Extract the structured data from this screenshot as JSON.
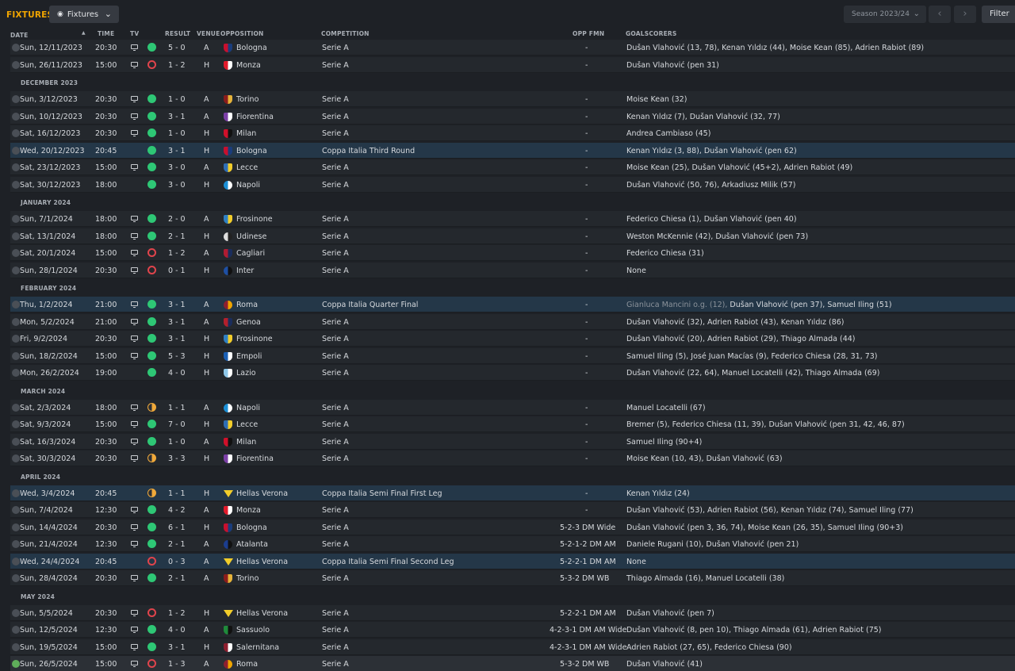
{
  "header": {
    "title": "FIXTURES",
    "view_label": "Fixtures",
    "season_label": "Season 2023/24",
    "filter_label": "Filter",
    "prev_icon": "chevron-left-icon",
    "next_icon": "chevron-right-icon"
  },
  "columns": {
    "date": "DATE",
    "time": "TIME",
    "tv": "TV",
    "result": "RESULT",
    "venue": "VENUE",
    "opposition": "OPPOSITION",
    "competition": "COMPETITION",
    "opp_fmn": "OPP FMN",
    "goalscorers": "GOALSCORERS"
  },
  "colors": {
    "accent": "#f0a500",
    "win": "#2ec775",
    "loss": "#e0444c",
    "draw": "#f0a93a",
    "cup_row": "#243748"
  },
  "rows": [
    {
      "type": "match",
      "date": "Sun, 12/11/2023",
      "time": "20:30",
      "tv": true,
      "outcome": "W",
      "score": "5 - 0",
      "venue": "A",
      "opponent": "Bologna",
      "crest": "#c8102e",
      "crest2": "#1a3d7c",
      "competition": "Serie A",
      "opp_fmn": "-",
      "scorers": "Dušan Vlahović (13, 78), Kenan Yıldız (44), Moise Kean (85), Adrien Rabiot (89)"
    },
    {
      "type": "match",
      "date": "Sun, 26/11/2023",
      "time": "15:00",
      "tv": true,
      "outcome": "L",
      "score": "1 - 2",
      "venue": "H",
      "opponent": "Monza",
      "crest": "#e21b2c",
      "crest2": "#ffffff",
      "competition": "Serie A",
      "opp_fmn": "-",
      "scorers": "Dušan Vlahović (pen 31)"
    },
    {
      "type": "month",
      "label": "DECEMBER 2023"
    },
    {
      "type": "match",
      "date": "Sun, 3/12/2023",
      "time": "20:30",
      "tv": true,
      "outcome": "W",
      "score": "1 - 0",
      "venue": "A",
      "opponent": "Torino",
      "crest": "#8a1c1c",
      "crest2": "#e6b33a",
      "competition": "Serie A",
      "opp_fmn": "-",
      "scorers": "Moise Kean (32)"
    },
    {
      "type": "match",
      "date": "Sun, 10/12/2023",
      "time": "20:30",
      "tv": true,
      "outcome": "W",
      "score": "3 - 1",
      "venue": "A",
      "opponent": "Fiorentina",
      "crest": "#7b3fa6",
      "crest2": "#ffffff",
      "competition": "Serie A",
      "opp_fmn": "-",
      "scorers": "Kenan Yıldız (7), Dušan Vlahović (32, 77)"
    },
    {
      "type": "match",
      "date": "Sat, 16/12/2023",
      "time": "20:30",
      "tv": true,
      "outcome": "W",
      "score": "1 - 0",
      "venue": "H",
      "opponent": "Milan",
      "crest": "#d0102a",
      "crest2": "#111111",
      "competition": "Serie A",
      "opp_fmn": "-",
      "scorers": "Andrea Cambiaso (45)"
    },
    {
      "type": "match",
      "cup": true,
      "date": "Wed, 20/12/2023",
      "time": "20:45",
      "tv": false,
      "outcome": "W",
      "score": "3 - 1",
      "venue": "H",
      "opponent": "Bologna",
      "crest": "#c8102e",
      "crest2": "#1a3d7c",
      "competition": "Coppa Italia Third Round",
      "opp_fmn": "-",
      "scorers": "Kenan Yıldız (3, 88), Dušan Vlahović (pen 62)"
    },
    {
      "type": "match",
      "date": "Sat, 23/12/2023",
      "time": "15:00",
      "tv": true,
      "outcome": "W",
      "score": "3 - 0",
      "venue": "A",
      "opponent": "Lecce",
      "crest": "#2e6db4",
      "crest2": "#f2cd2a",
      "competition": "Serie A",
      "opp_fmn": "-",
      "scorers": "Moise Kean (25), Dušan Vlahović (45+2), Adrien Rabiot (49)"
    },
    {
      "type": "match",
      "date": "Sat, 30/12/2023",
      "time": "18:00",
      "tv": false,
      "outcome": "W",
      "score": "3 - 0",
      "venue": "H",
      "opponent": "Napoli",
      "crest": "#1b8fd6",
      "crest2": "#ffffff",
      "round": true,
      "competition": "Serie A",
      "opp_fmn": "-",
      "scorers": "Dušan Vlahović (50, 76), Arkadiusz Milik (57)"
    },
    {
      "type": "month",
      "label": "JANUARY 2024"
    },
    {
      "type": "match",
      "date": "Sun, 7/1/2024",
      "time": "18:00",
      "tv": true,
      "outcome": "W",
      "score": "2 - 0",
      "venue": "A",
      "opponent": "Frosinone",
      "crest": "#2f7fc1",
      "crest2": "#f2cd2a",
      "competition": "Serie A",
      "opp_fmn": "-",
      "scorers": "Federico Chiesa (1), Dušan Vlahović (pen 40)"
    },
    {
      "type": "match",
      "date": "Sat, 13/1/2024",
      "time": "18:00",
      "tv": true,
      "outcome": "W",
      "score": "2 - 1",
      "venue": "H",
      "opponent": "Udinese",
      "crest": "#dddddd",
      "crest2": "#222222",
      "round": true,
      "competition": "Serie A",
      "opp_fmn": "-",
      "scorers": "Weston McKennie (42), Dušan Vlahović (pen 73)"
    },
    {
      "type": "match",
      "date": "Sat, 20/1/2024",
      "time": "15:00",
      "tv": true,
      "outcome": "L",
      "score": "1 - 2",
      "venue": "A",
      "opponent": "Cagliari",
      "crest": "#b01c32",
      "crest2": "#1a2d5c",
      "competition": "Serie A",
      "opp_fmn": "-",
      "scorers": "Federico Chiesa (31)"
    },
    {
      "type": "match",
      "date": "Sun, 28/1/2024",
      "time": "20:30",
      "tv": true,
      "outcome": "L",
      "score": "0 - 1",
      "venue": "H",
      "opponent": "Inter",
      "crest": "#1e4fa3",
      "crest2": "#111111",
      "round": true,
      "competition": "Serie A",
      "opp_fmn": "-",
      "scorers": "None"
    },
    {
      "type": "month",
      "label": "FEBRUARY 2024"
    },
    {
      "type": "match",
      "cup": true,
      "date": "Thu, 1/2/2024",
      "time": "21:00",
      "tv": true,
      "outcome": "W",
      "score": "3 - 1",
      "venue": "A",
      "opponent": "Roma",
      "crest": "#8e1f2f",
      "crest2": "#f0a500",
      "round": true,
      "competition": "Coppa Italia Quarter Final",
      "opp_fmn": "-",
      "scorers_og": "Gianluca Mancini o.g. (12),",
      "scorers": " Dušan Vlahović (pen 37), Samuel Iling (51)"
    },
    {
      "type": "match",
      "date": "Mon, 5/2/2024",
      "time": "21:00",
      "tv": true,
      "outcome": "W",
      "score": "3 - 1",
      "venue": "A",
      "opponent": "Genoa",
      "crest": "#b3202c",
      "crest2": "#1a2d5c",
      "competition": "Serie A",
      "opp_fmn": "-",
      "scorers": "Dušan Vlahović (32), Adrien Rabiot (43), Kenan Yıldız (86)"
    },
    {
      "type": "match",
      "date": "Fri, 9/2/2024",
      "time": "20:30",
      "tv": true,
      "outcome": "W",
      "score": "3 - 1",
      "venue": "H",
      "opponent": "Frosinone",
      "crest": "#2f7fc1",
      "crest2": "#f2cd2a",
      "competition": "Serie A",
      "opp_fmn": "-",
      "scorers": "Dušan Vlahović (20), Adrien Rabiot (29), Thiago Almada (44)"
    },
    {
      "type": "match",
      "date": "Sun, 18/2/2024",
      "time": "15:00",
      "tv": true,
      "outcome": "W",
      "score": "5 - 3",
      "venue": "H",
      "opponent": "Empoli",
      "crest": "#1a5fb4",
      "crest2": "#ffffff",
      "competition": "Serie A",
      "opp_fmn": "-",
      "scorers": "Samuel Iling (5), José Juan Macías (9), Federico Chiesa (28, 31, 73)"
    },
    {
      "type": "match",
      "date": "Mon, 26/2/2024",
      "time": "19:00",
      "tv": false,
      "outcome": "W",
      "score": "4 - 0",
      "venue": "H",
      "opponent": "Lazio",
      "crest": "#8fc8ea",
      "crest2": "#ffffff",
      "competition": "Serie A",
      "opp_fmn": "-",
      "scorers": "Dušan Vlahović (22, 64), Manuel Locatelli (42), Thiago Almada (69)"
    },
    {
      "type": "month",
      "label": "MARCH 2024"
    },
    {
      "type": "match",
      "date": "Sat, 2/3/2024",
      "time": "18:00",
      "tv": true,
      "outcome": "D",
      "score": "1 - 1",
      "venue": "A",
      "opponent": "Napoli",
      "crest": "#1b8fd6",
      "crest2": "#ffffff",
      "round": true,
      "competition": "Serie A",
      "opp_fmn": "-",
      "scorers": "Manuel Locatelli (67)"
    },
    {
      "type": "match",
      "date": "Sat, 9/3/2024",
      "time": "15:00",
      "tv": true,
      "outcome": "W",
      "score": "7 - 0",
      "venue": "H",
      "opponent": "Lecce",
      "crest": "#2e6db4",
      "crest2": "#f2cd2a",
      "competition": "Serie A",
      "opp_fmn": "-",
      "scorers": "Bremer (5), Federico Chiesa (11, 39), Dušan Vlahović (pen 31, 42, 46, 87)"
    },
    {
      "type": "match",
      "date": "Sat, 16/3/2024",
      "time": "20:30",
      "tv": true,
      "outcome": "W",
      "score": "1 - 0",
      "venue": "A",
      "opponent": "Milan",
      "crest": "#d0102a",
      "crest2": "#111111",
      "competition": "Serie A",
      "opp_fmn": "-",
      "scorers": "Samuel Iling (90+4)"
    },
    {
      "type": "match",
      "date": "Sat, 30/3/2024",
      "time": "20:30",
      "tv": true,
      "outcome": "D",
      "score": "3 - 3",
      "venue": "H",
      "opponent": "Fiorentina",
      "crest": "#7b3fa6",
      "crest2": "#ffffff",
      "competition": "Serie A",
      "opp_fmn": "-",
      "scorers": "Moise Kean (10, 43), Dušan Vlahović (63)"
    },
    {
      "type": "month",
      "label": "APRIL 2024"
    },
    {
      "type": "match",
      "cup": true,
      "date": "Wed, 3/4/2024",
      "time": "20:45",
      "tv": false,
      "outcome": "D",
      "score": "1 - 1",
      "venue": "H",
      "opponent": "Hellas Verona",
      "crest": "#f2cd2a",
      "crest2": "#1a2d5c",
      "chevron": true,
      "competition": "Coppa Italia Semi Final First Leg",
      "opp_fmn": "-",
      "scorers": "Kenan Yıldız (24)"
    },
    {
      "type": "match",
      "date": "Sun, 7/4/2024",
      "time": "12:30",
      "tv": true,
      "outcome": "W",
      "score": "4 - 2",
      "venue": "A",
      "opponent": "Monza",
      "crest": "#e21b2c",
      "crest2": "#ffffff",
      "competition": "Serie A",
      "opp_fmn": "-",
      "scorers": "Dušan Vlahović (53), Adrien Rabiot (56), Kenan Yıldız (74), Samuel Iling (77)"
    },
    {
      "type": "match",
      "date": "Sun, 14/4/2024",
      "time": "20:30",
      "tv": true,
      "outcome": "W",
      "score": "6 - 1",
      "venue": "H",
      "opponent": "Bologna",
      "crest": "#c8102e",
      "crest2": "#1a3d7c",
      "competition": "Serie A",
      "opp_fmn": "5-2-3 DM Wide",
      "scorers": "Dušan Vlahović (pen 3, 36, 74), Moise Kean (26, 35), Samuel Iling (90+3)"
    },
    {
      "type": "match",
      "date": "Sun, 21/4/2024",
      "time": "12:30",
      "tv": true,
      "outcome": "W",
      "score": "2 - 1",
      "venue": "A",
      "opponent": "Atalanta",
      "crest": "#1b3d8f",
      "crest2": "#111111",
      "round": true,
      "competition": "Serie A",
      "opp_fmn": "5-2-1-2 DM AM",
      "scorers": "Daniele Rugani (10), Dušan Vlahović (pen 21)"
    },
    {
      "type": "match",
      "cup": true,
      "date": "Wed, 24/4/2024",
      "time": "20:45",
      "tv": false,
      "outcome": "L",
      "score": "0 - 3",
      "venue": "A",
      "opponent": "Hellas Verona",
      "crest": "#f2cd2a",
      "crest2": "#1a2d5c",
      "chevron": true,
      "competition": "Coppa Italia Semi Final Second Leg",
      "opp_fmn": "5-2-2-1 DM AM",
      "scorers": "None"
    },
    {
      "type": "match",
      "date": "Sun, 28/4/2024",
      "time": "20:30",
      "tv": true,
      "outcome": "W",
      "score": "2 - 1",
      "venue": "A",
      "opponent": "Torino",
      "crest": "#8a1c1c",
      "crest2": "#e6b33a",
      "competition": "Serie A",
      "opp_fmn": "5-3-2 DM WB",
      "scorers": "Thiago Almada (16), Manuel Locatelli (38)"
    },
    {
      "type": "month",
      "label": "MAY 2024"
    },
    {
      "type": "match",
      "date": "Sun, 5/5/2024",
      "time": "20:30",
      "tv": true,
      "outcome": "L",
      "score": "1 - 2",
      "venue": "H",
      "opponent": "Hellas Verona",
      "crest": "#f2cd2a",
      "crest2": "#1a2d5c",
      "chevron": true,
      "competition": "Serie A",
      "opp_fmn": "5-2-2-1 DM AM",
      "scorers": "Dušan Vlahović (pen 7)"
    },
    {
      "type": "match",
      "date": "Sun, 12/5/2024",
      "time": "12:30",
      "tv": true,
      "outcome": "W",
      "score": "4 - 0",
      "venue": "A",
      "opponent": "Sassuolo",
      "crest": "#1f8a3b",
      "crest2": "#111111",
      "competition": "Serie A",
      "opp_fmn": "4-2-3-1 DM AM Wide",
      "scorers": "Dušan Vlahović (8, pen 10), Thiago Almada (61), Adrien Rabiot (75)"
    },
    {
      "type": "match",
      "date": "Sun, 19/5/2024",
      "time": "15:00",
      "tv": true,
      "outcome": "W",
      "score": "3 - 1",
      "venue": "H",
      "opponent": "Salernitana",
      "crest": "#8e1f2f",
      "crest2": "#ffffff",
      "competition": "Serie A",
      "opp_fmn": "4-2-3-1 DM AM Wide",
      "scorers": "Adrien Rabiot (27, 65), Federico Chiesa (90)"
    },
    {
      "type": "match",
      "last": true,
      "checked": true,
      "date": "Sun, 26/5/2024",
      "time": "15:00",
      "tv": true,
      "outcome": "L",
      "score": "1 - 3",
      "venue": "A",
      "opponent": "Roma",
      "crest": "#8e1f2f",
      "crest2": "#f0a500",
      "round": true,
      "competition": "Serie A",
      "opp_fmn": "5-3-2 DM WB",
      "scorers": "Dušan Vlahović (41)"
    }
  ]
}
